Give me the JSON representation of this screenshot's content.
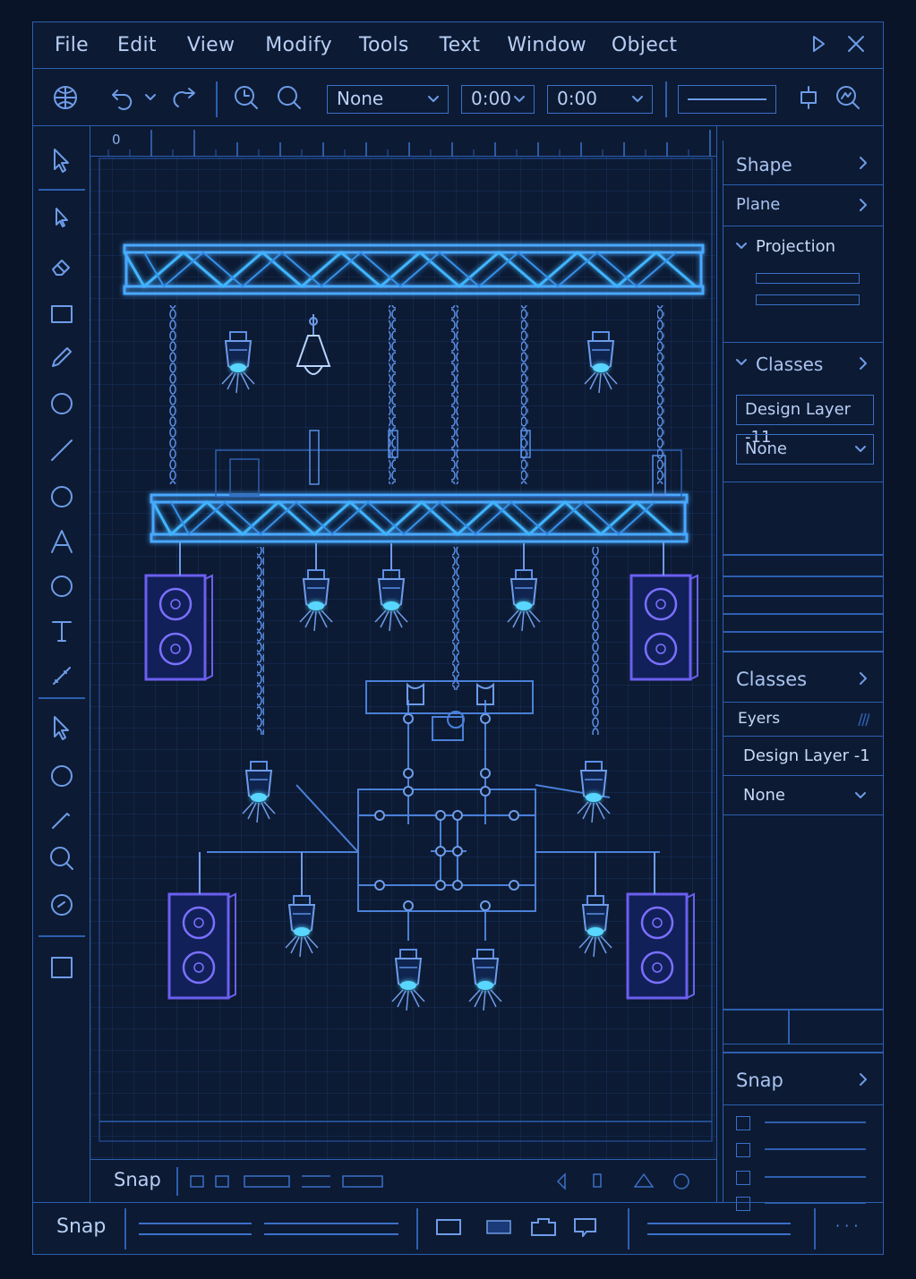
{
  "menu": [
    "File",
    "Edit",
    "View",
    "Modify",
    "Tools",
    "Text",
    "Window",
    "Object"
  ],
  "toolbar": {
    "class_select": "None",
    "time_a": "0:00",
    "time_b": "0:00"
  },
  "ruler": {
    "origin": "0"
  },
  "canvas_bottom": {
    "label": "Snap"
  },
  "panel": {
    "shape": "Shape",
    "plane": "Plane",
    "projection": "Projection",
    "classes_1": "Classes",
    "layer_1": "Design Layer -11",
    "select_1": "None",
    "classes_2": "Classes",
    "eyers": "Eyers",
    "layer_2": "Design Layer -1",
    "select_2": "None",
    "snap": "Snap"
  },
  "statusbar": {
    "label": "Snap",
    "dots": "· · ·"
  },
  "colors": {
    "background": "#0a1428",
    "line": "#2d5fb0",
    "accent": "#3fb4ff",
    "speaker": "#5b4fd8"
  }
}
